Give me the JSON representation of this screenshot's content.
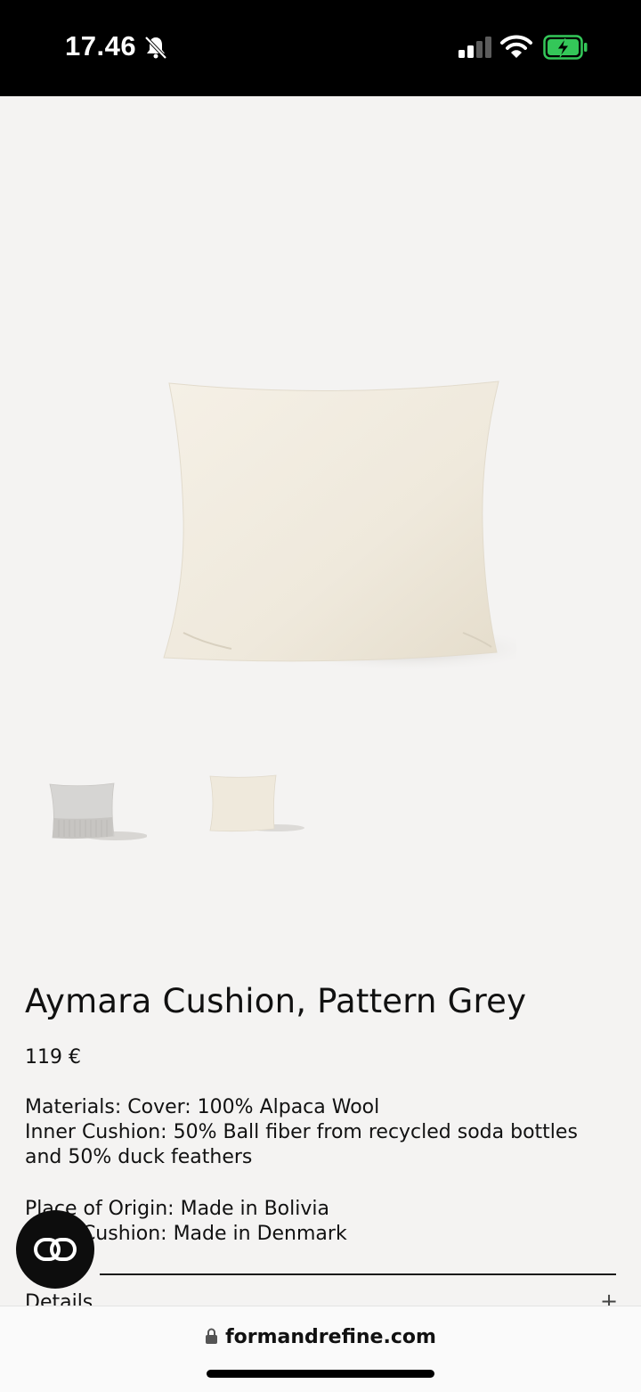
{
  "status_bar": {
    "time": "17.46"
  },
  "product": {
    "title": "Aymara Cushion, Pattern Grey",
    "price": "119 €",
    "materials": [
      "Materials: Cover: 100% Alpaca Wool",
      "Inner Cushion: 50% Ball fiber from recycled soda bottles",
      "and 50% duck feathers"
    ],
    "origin": [
      "Place of Origin: Made in Bolivia",
      "Inner Cushion: Made in Denmark"
    ]
  },
  "accordion": {
    "details_label": "Details",
    "expand_symbol": "+"
  },
  "browser": {
    "url": "formandrefine.com"
  },
  "icons": {
    "status": [
      "bell-muted-icon",
      "signal-icon",
      "wifi-icon",
      "battery-charging-icon"
    ],
    "cta": "link-icon",
    "url": "lock-icon"
  },
  "colors": {
    "status_bar_bg": "#000000",
    "page_bg": "#f4f3f2",
    "cushion": "#efe9dc",
    "battery_green": "#34c759"
  }
}
